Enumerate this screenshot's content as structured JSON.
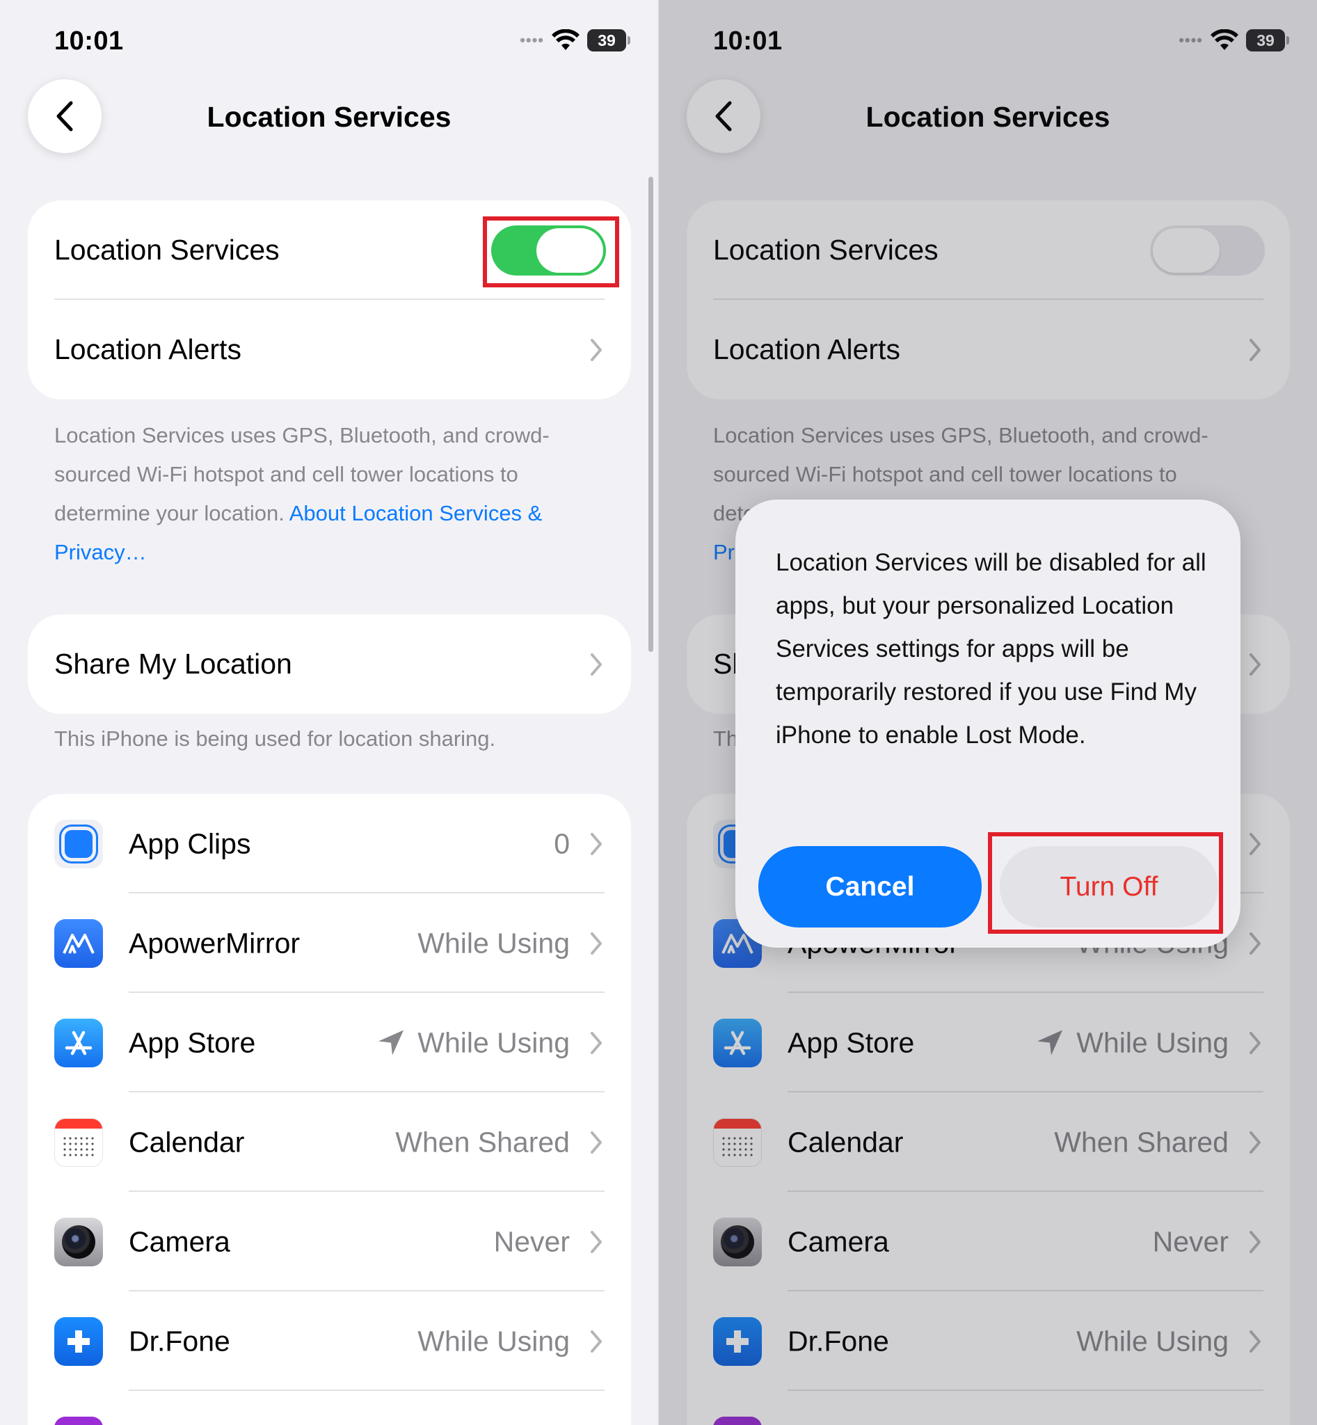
{
  "status": {
    "time": "10:01",
    "battery": "39"
  },
  "page": {
    "title": "Location Services"
  },
  "settings": {
    "location_services_label": "Location Services",
    "location_alerts_label": "Location Alerts",
    "location_services_left": "on",
    "location_services_right": "off"
  },
  "footer": {
    "text": "Location Services uses GPS, Bluetooth, and crowd-sourced Wi-Fi hotspot and cell tower locations to determine your location.",
    "link": "About Location Services & Privacy…"
  },
  "share": {
    "label": "Share My Location",
    "note": "This iPhone is being used for location sharing."
  },
  "apps": [
    {
      "name": "App Clips",
      "value": "0",
      "icon": "app-clips-icon",
      "arrow": false
    },
    {
      "name": "ApowerMirror",
      "value": "While Using",
      "icon": "apowermirror-icon",
      "arrow": false
    },
    {
      "name": "App Store",
      "value": "While Using",
      "icon": "app-store-icon",
      "arrow": true
    },
    {
      "name": "Calendar",
      "value": "When Shared",
      "icon": "calendar-icon",
      "arrow": false
    },
    {
      "name": "Camera",
      "value": "Never",
      "icon": "camera-icon",
      "arrow": false
    },
    {
      "name": "Dr.Fone",
      "value": "While Using",
      "icon": "drfone-icon",
      "arrow": false
    }
  ],
  "alert": {
    "message": "Location Services will be disabled for all apps, but your personalized Location Services settings for apps will be temporarily restored if you use Find My iPhone to enable Lost Mode.",
    "cancel": "Cancel",
    "turn_off": "Turn Off"
  },
  "colors": {
    "accent": "#0a7aff",
    "toggle_on": "#34c759",
    "destructive": "#e8302a",
    "highlight": "#e0202a"
  }
}
